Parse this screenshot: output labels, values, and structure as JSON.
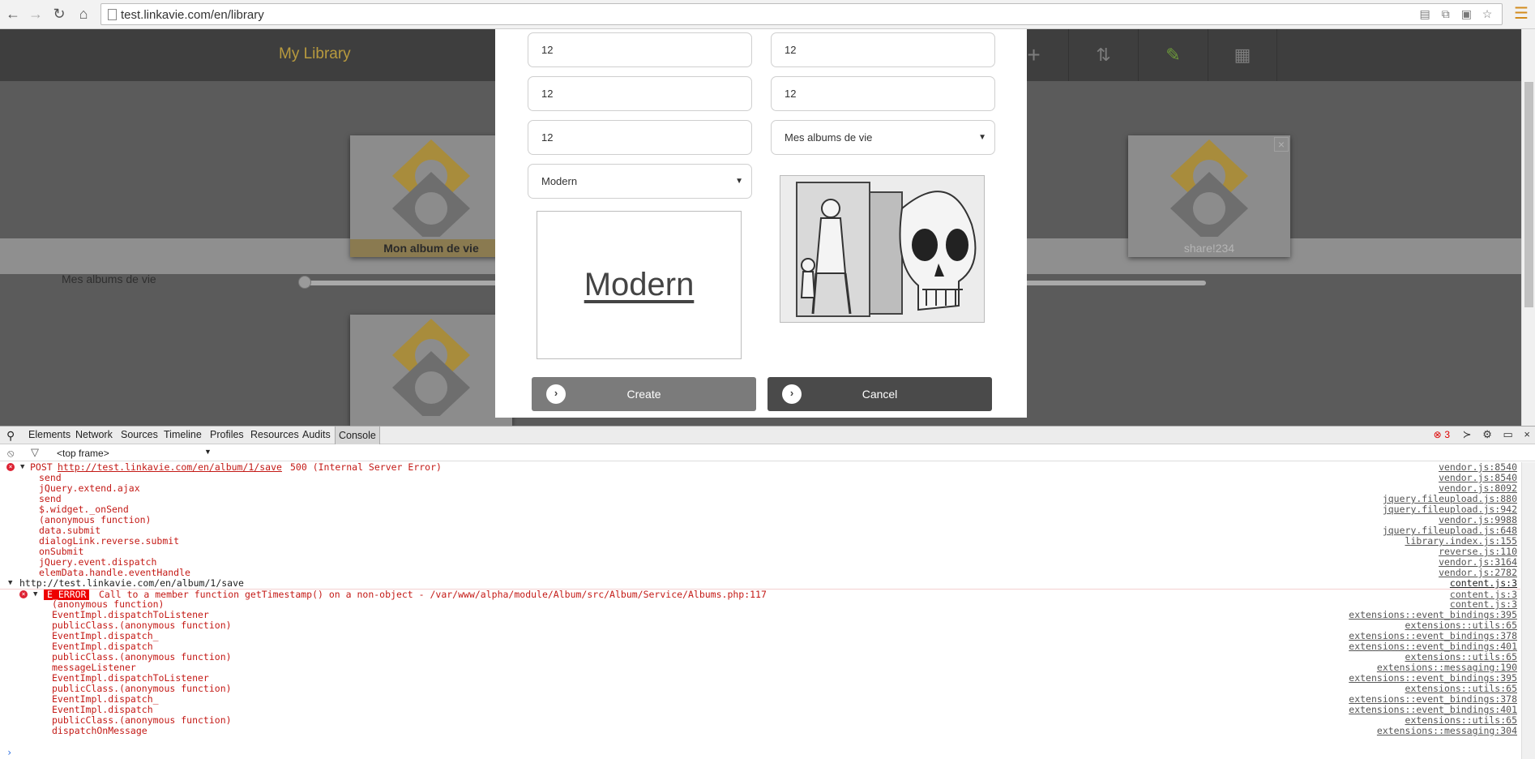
{
  "browser": {
    "url": "test.linkavie.com/en/library",
    "icons": [
      "back-icon",
      "forward-icon",
      "reload-icon",
      "home-icon"
    ]
  },
  "library": {
    "title": "My Library",
    "shelf_label": "Mes albums de vie",
    "albums": [
      {
        "caption": "Mon album de vie"
      },
      {
        "caption": "share!234"
      }
    ]
  },
  "modal": {
    "fields": [
      "12",
      "12",
      "12",
      "12",
      "12"
    ],
    "category_select": "Mes albums de vie",
    "style_select": "Modern",
    "preview_text": "Modern",
    "create_label": "Create",
    "cancel_label": "Cancel"
  },
  "devtools": {
    "tabs": [
      "Elements",
      "Network",
      "Sources",
      "Timeline",
      "Profiles",
      "Resources",
      "Audits",
      "Console"
    ],
    "active_tab": "Console",
    "error_count": "3",
    "frame": "<top frame>",
    "post_error": {
      "method": "POST",
      "url": "http://test.linkavie.com/en/album/1/save",
      "status": "500 (Internal Server Error)",
      "source": "vendor.js:8540",
      "stack": [
        {
          "fn": "send",
          "src": "vendor.js:8540"
        },
        {
          "fn": "jQuery.extend.ajax",
          "src": "vendor.js:8092"
        },
        {
          "fn": "send",
          "src": "jquery.fileupload.js:880"
        },
        {
          "fn": "$.widget._onSend",
          "src": "jquery.fileupload.js:942"
        },
        {
          "fn": "(anonymous function)",
          "src": "vendor.js:9988"
        },
        {
          "fn": "data.submit",
          "src": "jquery.fileupload.js:648"
        },
        {
          "fn": "dialogLink.reverse.submit",
          "src": "library.index.js:155"
        },
        {
          "fn": "onSubmit",
          "src": "reverse.js:110"
        },
        {
          "fn": "jQuery.event.dispatch",
          "src": "vendor.js:3164"
        },
        {
          "fn": "elemData.handle.eventHandle",
          "src": "vendor.js:2782"
        }
      ]
    },
    "group_url": "http://test.linkavie.com/en/album/1/save",
    "group_src": "content.js:3",
    "e_error": {
      "badge": "E_ERROR",
      "message": "Call to a member function getTimestamp() on a non-object - /var/www/alpha/module/Album/src/Album/Service/Albums.php:117",
      "source": "content.js:3",
      "stack": [
        {
          "fn": "(anonymous function)",
          "src": "content.js:3"
        },
        {
          "fn": "EventImpl.dispatchToListener",
          "src": "extensions::event_bindings:395"
        },
        {
          "fn": "publicClass.(anonymous function)",
          "src": "extensions::utils:65"
        },
        {
          "fn": "EventImpl.dispatch_",
          "src": "extensions::event_bindings:378"
        },
        {
          "fn": "EventImpl.dispatch",
          "src": "extensions::event_bindings:401"
        },
        {
          "fn": "publicClass.(anonymous function)",
          "src": "extensions::utils:65"
        },
        {
          "fn": "messageListener",
          "src": "extensions::messaging:190"
        },
        {
          "fn": "EventImpl.dispatchToListener",
          "src": "extensions::event_bindings:395"
        },
        {
          "fn": "publicClass.(anonymous function)",
          "src": "extensions::utils:65"
        },
        {
          "fn": "EventImpl.dispatch_",
          "src": "extensions::event_bindings:378"
        },
        {
          "fn": "EventImpl.dispatch",
          "src": "extensions::event_bindings:401"
        },
        {
          "fn": "publicClass.(anonymous function)",
          "src": "extensions::utils:65"
        },
        {
          "fn": "dispatchOnMessage",
          "src": "extensions::messaging:304"
        }
      ]
    }
  }
}
